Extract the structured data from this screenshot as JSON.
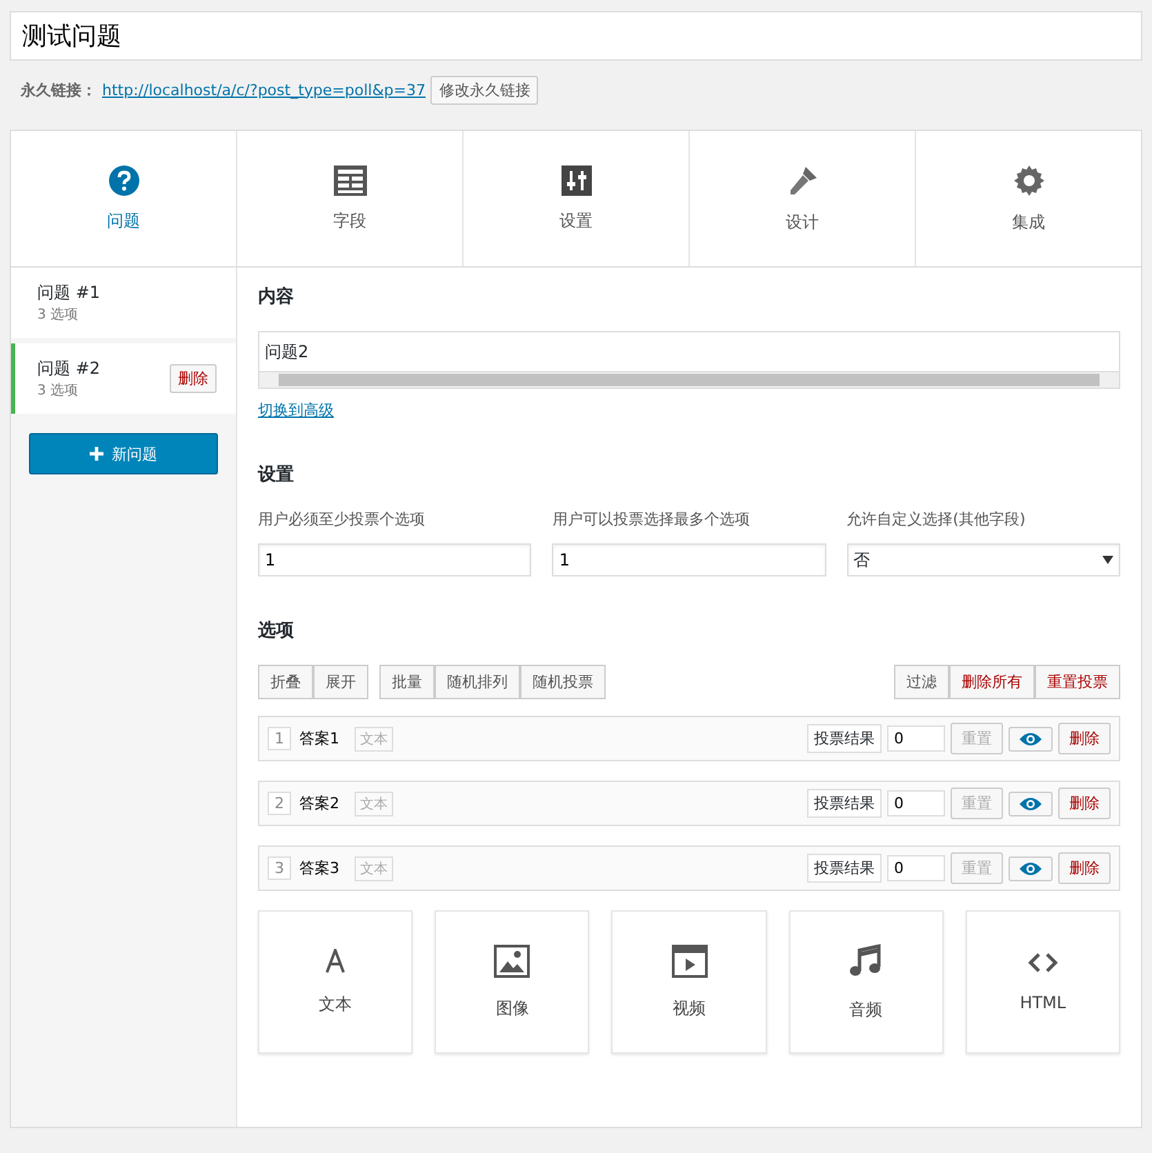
{
  "title_field": {
    "value": "测试问题"
  },
  "permalink": {
    "label": "永久链接：",
    "url": "http://localhost/a/c/?post_type=poll&p=37",
    "edit_button": "修改永久链接"
  },
  "tabs": [
    {
      "label": "问题",
      "kind": "question",
      "selected": true
    },
    {
      "label": "字段",
      "kind": "form",
      "selected": false
    },
    {
      "label": "设置",
      "kind": "sliders",
      "selected": false
    },
    {
      "label": "设计",
      "kind": "brush",
      "selected": false
    },
    {
      "label": "集成",
      "kind": "gear",
      "selected": false
    }
  ],
  "questions": [
    {
      "title": "问题 #1",
      "subtitle": "3 选项",
      "selected": false
    },
    {
      "title": "问题 #2",
      "subtitle": "3 选项",
      "selected": true,
      "delete_button": "删除"
    }
  ],
  "new_question_button": "新问题",
  "content": {
    "heading": "内容",
    "value": "问题2",
    "advanced_link": "切换到高级"
  },
  "settings": {
    "heading": "设置",
    "fields": [
      {
        "kind": "text",
        "label": "用户必须至少投票个选项",
        "value": "1"
      },
      {
        "kind": "text",
        "label": "用户可以投票选择最多个选项",
        "value": "1"
      },
      {
        "kind": "select",
        "label": "允许自定义选择(其他字段)",
        "value": "否"
      }
    ]
  },
  "choices": {
    "heading": "选项",
    "left_groups": [
      [
        "折叠",
        "展开"
      ],
      [
        "批量",
        "随机排列",
        "随机投票"
      ]
    ],
    "right_buttons": [
      {
        "label": "过滤",
        "danger": false
      },
      {
        "label": "删除所有",
        "danger": true
      },
      {
        "label": "重置投票",
        "danger": true
      }
    ],
    "items": [
      {
        "number": "1",
        "value": "答案1",
        "type": "文本",
        "votes_label": "投票结果",
        "votes": "0",
        "reset": "重置",
        "delete": "删除"
      },
      {
        "number": "2",
        "value": "答案2",
        "type": "文本",
        "votes_label": "投票结果",
        "votes": "0",
        "reset": "重置",
        "delete": "删除"
      },
      {
        "number": "3",
        "value": "答案3",
        "type": "文本",
        "votes_label": "投票结果",
        "votes": "0",
        "reset": "重置",
        "delete": "删除"
      }
    ],
    "add_types": [
      {
        "label": "文本",
        "kind": "text"
      },
      {
        "label": "图像",
        "kind": "image"
      },
      {
        "label": "视频",
        "kind": "video"
      },
      {
        "label": "音频",
        "kind": "music"
      },
      {
        "label": "HTML",
        "kind": "code"
      }
    ]
  }
}
